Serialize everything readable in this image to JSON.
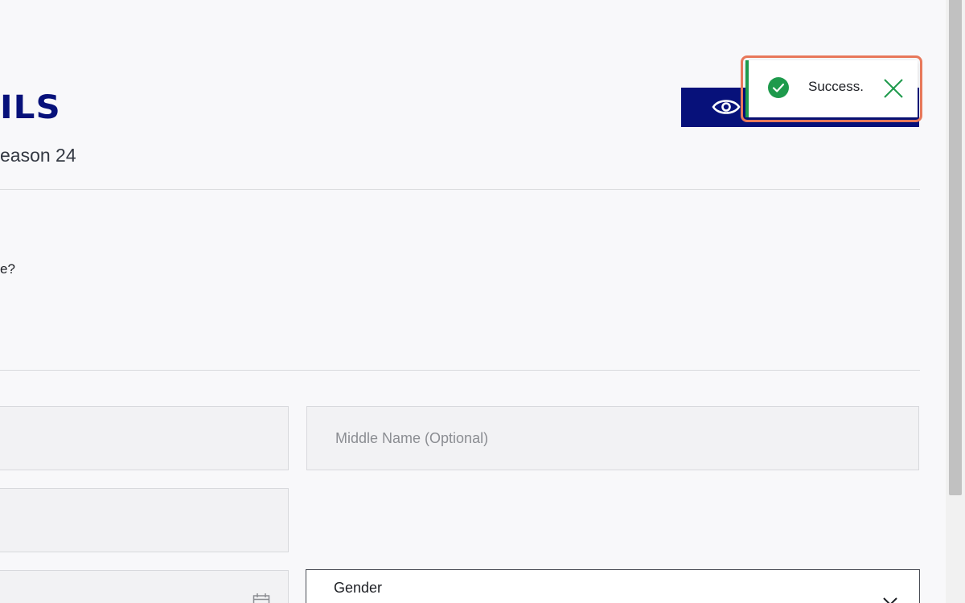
{
  "page": {
    "title": "ILS",
    "subtitle": "eason 24",
    "question_fragment": "e?"
  },
  "header": {
    "preview_button": {
      "icon": "eye-icon"
    }
  },
  "form": {
    "first_name": {
      "placeholder": ""
    },
    "middle_name": {
      "placeholder": "Middle Name (Optional)"
    },
    "last_name": {
      "placeholder": ""
    },
    "date_of_birth": {
      "placeholder": "",
      "icon": "calendar-icon"
    },
    "gender": {
      "label": "Gender",
      "icon": "chevron-down-icon"
    }
  },
  "toast": {
    "status": "success",
    "message": "Success.",
    "icon": "check-circle-icon",
    "close_icon": "close-icon"
  },
  "colors": {
    "brand_navy": "#07117a",
    "success_green": "#1e9a4c",
    "highlight_orange": "#e8785a",
    "page_background": "#f8f8fa"
  }
}
